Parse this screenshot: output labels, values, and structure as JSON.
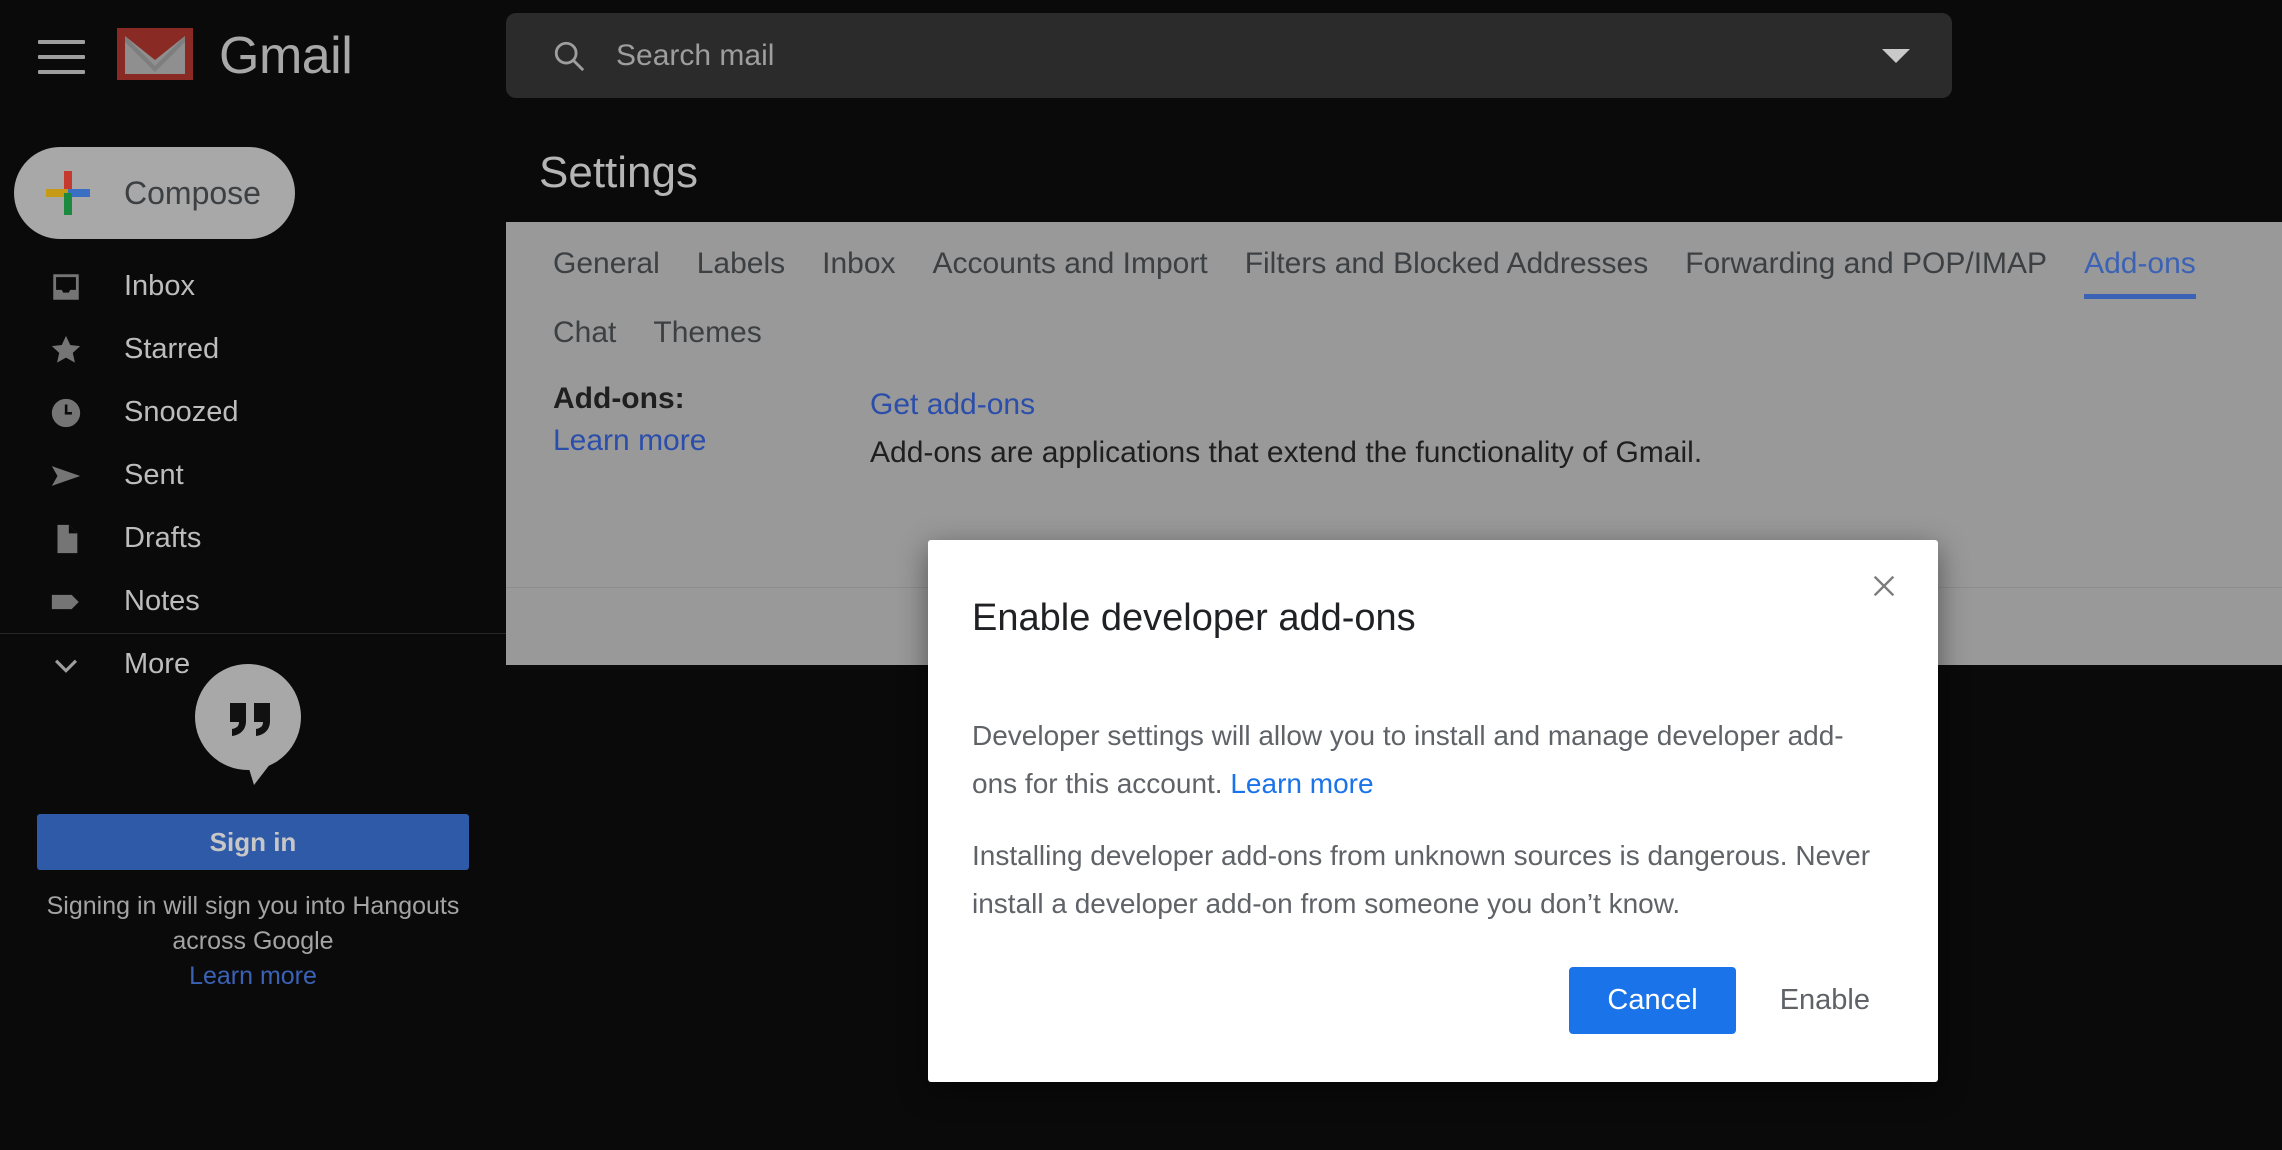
{
  "header": {
    "menu_icon": "hamburger-icon",
    "logo_icon": "gmail-logo-icon",
    "brand": "Gmail"
  },
  "search": {
    "icon": "search-icon",
    "placeholder": "Search mail",
    "value": "",
    "dropdown_icon": "chevron-down-icon"
  },
  "sidebar": {
    "compose": {
      "label": "Compose",
      "icon": "plus-icon"
    },
    "items": [
      {
        "label": "Inbox",
        "icon": "inbox-icon"
      },
      {
        "label": "Starred",
        "icon": "star-icon"
      },
      {
        "label": "Snoozed",
        "icon": "clock-icon"
      },
      {
        "label": "Sent",
        "icon": "send-icon"
      },
      {
        "label": "Drafts",
        "icon": "document-icon"
      },
      {
        "label": "Notes",
        "icon": "label-icon"
      },
      {
        "label": "More",
        "icon": "chevron-down-icon"
      }
    ],
    "hangouts": {
      "icon": "hangouts-quote-icon",
      "sign_in_label": "Sign in",
      "note_line1": "Signing in will sign you into Hangouts",
      "note_line2": "across Google",
      "learn_more": "Learn more"
    }
  },
  "settings": {
    "title": "Settings",
    "tabs": [
      {
        "label": "General",
        "active": false
      },
      {
        "label": "Labels",
        "active": false
      },
      {
        "label": "Inbox",
        "active": false
      },
      {
        "label": "Accounts and Import",
        "active": false
      },
      {
        "label": "Filters and Blocked Addresses",
        "active": false
      },
      {
        "label": "Forwarding and POP/IMAP",
        "active": false
      },
      {
        "label": "Add-ons",
        "active": true
      },
      {
        "label": "Chat",
        "active": false
      },
      {
        "label": "Themes",
        "active": false
      }
    ],
    "addons": {
      "label": "Add-ons:",
      "learn_more": "Learn more",
      "get_addons": "Get add-ons",
      "description": "Add-ons are applications that extend the functionality of Gmail."
    }
  },
  "dialog": {
    "title": "Enable developer add-ons",
    "close_icon": "close-icon",
    "paragraph1_text": "Developer settings will allow you to install and manage developer add-ons for this account. ",
    "paragraph1_link": "Learn more",
    "paragraph2": "Installing developer add-ons from unknown sources is dangerous. Never install a developer add-on from someone you don’t know.",
    "cancel_label": "Cancel",
    "enable_label": "Enable"
  },
  "colors": {
    "accent_blue": "#1a73e8",
    "link_blue": "#2b4eaa",
    "panel_gray": "#999999",
    "background": "#0a0a0a",
    "signin_blue": "#2f5aa8"
  }
}
